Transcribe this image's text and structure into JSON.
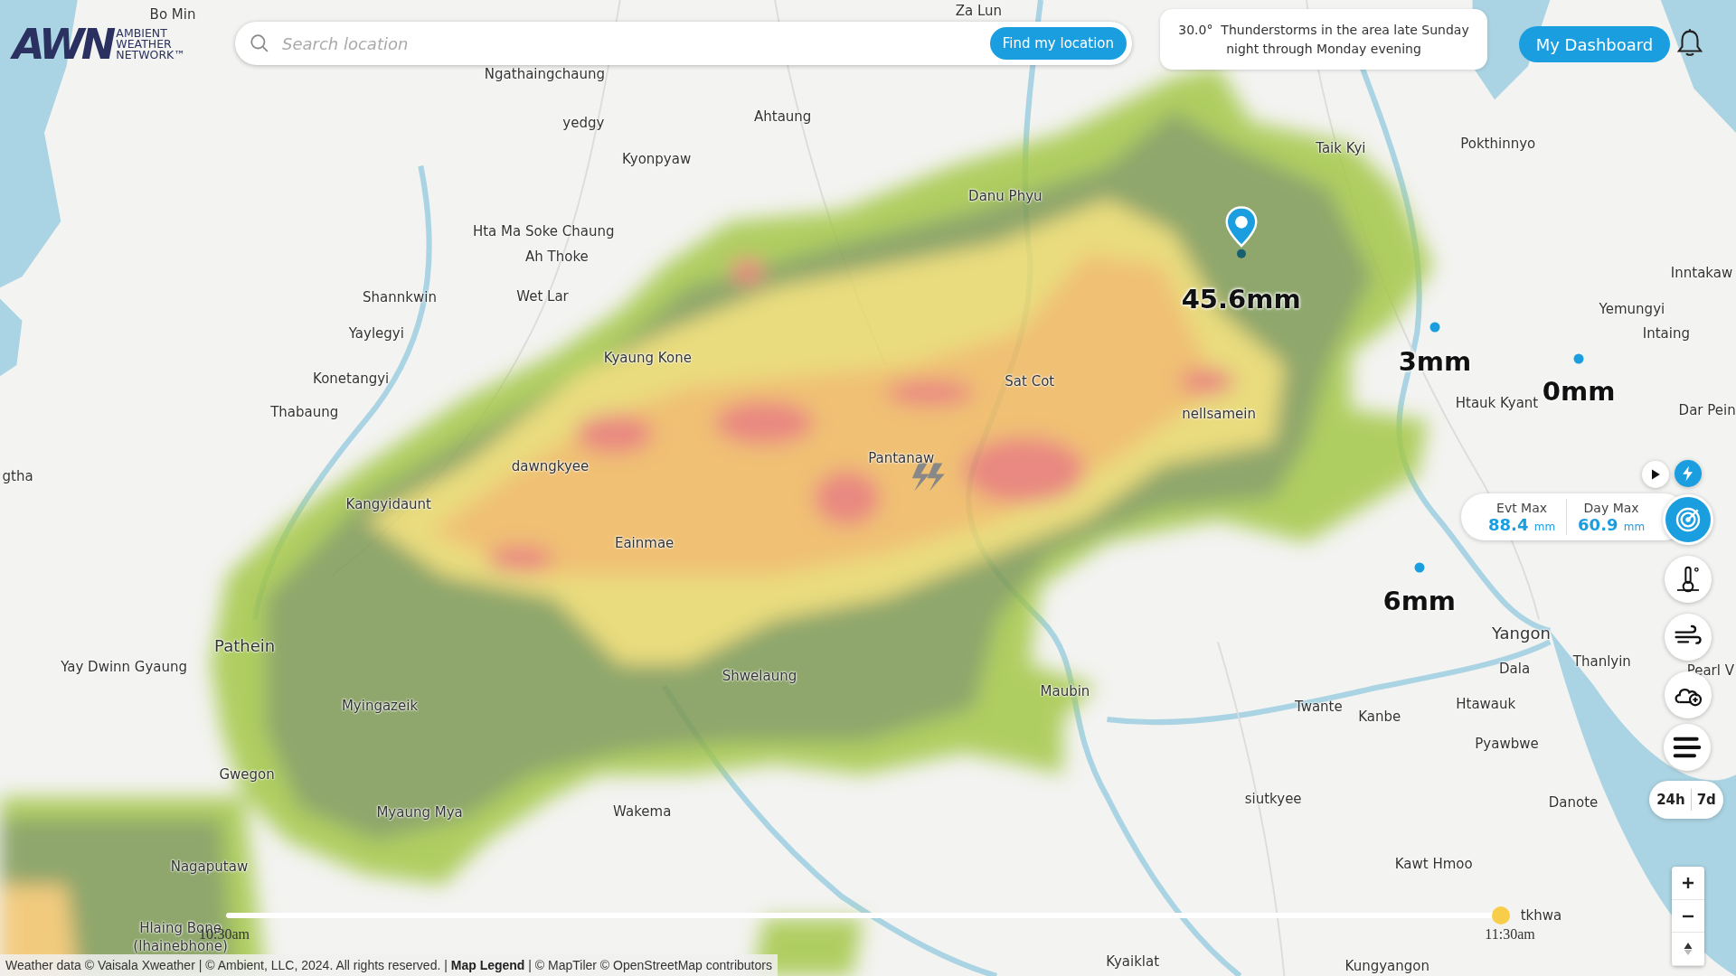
{
  "header": {
    "logo": {
      "letters": "AWN",
      "lines": [
        "AMBIENT",
        "WEATHER",
        "NETWORK™"
      ]
    },
    "search": {
      "placeholder": "Search location"
    },
    "find_button": "Find my location",
    "alert": {
      "temperature": "30.0°",
      "text": "Thunderstorms in the area late Sunday night through Monday evening"
    },
    "dashboard_button": "My Dashboard"
  },
  "map": {
    "place_labels": [
      "Bo Min",
      "Za Lun",
      "Ngathaingchaung",
      "yedgy",
      "Ahtaung",
      "Kyonpyaw",
      "Taik Kyi",
      "Pokthinnyo",
      "Danu Phyu",
      "Hta Ma Soke Chaung",
      "Ah Thoke",
      "Inntakaw",
      "Shannkwin",
      "Wet Lar",
      "Yemungyi",
      "Yaylegyi",
      "Intaing",
      "Kyaung Kone",
      "Konetangyi",
      "Sat Cot",
      "Htauk Kyant",
      "Thabaung",
      "nellsamein",
      "Dar Pein",
      "gtha",
      "dawngkyee",
      "Pantanaw",
      "Kangyidaunt",
      "Eainmae",
      "Yangon",
      "Pathein",
      "Yay Dwinn Gyaung",
      "Dala",
      "Thanlyin",
      "Pearl V",
      "Shwelaung",
      "Maubin",
      "Myingazeik",
      "Twante",
      "Kanbe",
      "Htawauk",
      "Pyawbwe",
      "Gwegon",
      "Danote",
      "siutkyee",
      "Wakema",
      "Myaung Mya",
      "Nagaputaw",
      "Kawt Hmoo",
      "Hlaing Bone",
      "(lhainebhone)",
      "tkhwa",
      "Kyaiklat",
      "Kungyangon"
    ],
    "rain_readings": [
      {
        "kind": "pin",
        "value": "45.6mm"
      },
      {
        "kind": "dot",
        "value": "3mm"
      },
      {
        "kind": "dot",
        "value": "0mm"
      },
      {
        "kind": "dot",
        "value": "6mm"
      }
    ]
  },
  "layers": [
    {
      "kind": "lightning",
      "selected": true
    },
    {
      "kind": "radar",
      "selected": true
    },
    {
      "kind": "temperature",
      "selected": false
    },
    {
      "kind": "wind",
      "selected": false
    },
    {
      "kind": "clouds",
      "selected": false
    }
  ],
  "stats": [
    {
      "label": "Evt Max",
      "value": "88.4",
      "unit": "mm"
    },
    {
      "label": "Day Max",
      "value": "60.9",
      "unit": "mm"
    }
  ],
  "range_toggle": [
    "24h",
    "7d"
  ],
  "timeline": {
    "start": "10:30am",
    "end": "11:30am",
    "level": 1.0
  },
  "attribution": {
    "text": "Weather data © Vaisala Xweather | © Ambient, LLC, 2024. All rights reserved. |",
    "link": "Map Legend",
    "tail": "| © MapTiler © OpenStreetMap contributors"
  }
}
